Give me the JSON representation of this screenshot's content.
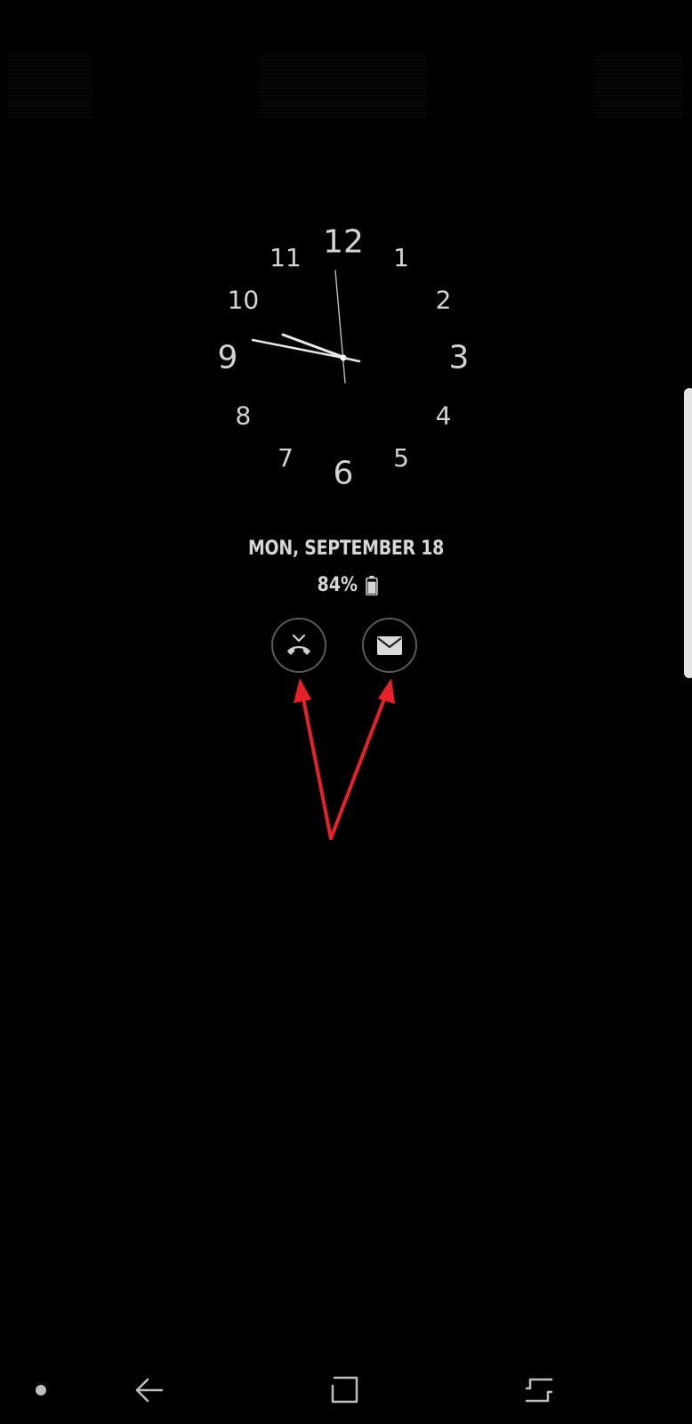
{
  "clock": {
    "numbers": [
      "12",
      "1",
      "2",
      "3",
      "4",
      "5",
      "6",
      "7",
      "8",
      "9",
      "10",
      "11"
    ],
    "time": "9:52"
  },
  "date_text": "MON, SEPTEMBER 18",
  "battery": {
    "percent_text": "84%",
    "level": 0.84
  },
  "notifications": [
    {
      "name": "missed-call",
      "icon": "missed-call-icon"
    },
    {
      "name": "message",
      "icon": "envelope-icon"
    }
  ],
  "annotation": {
    "arrow_color": "#e8202a"
  },
  "navigation": {
    "buttons": [
      "dot",
      "back",
      "home",
      "recents"
    ]
  }
}
